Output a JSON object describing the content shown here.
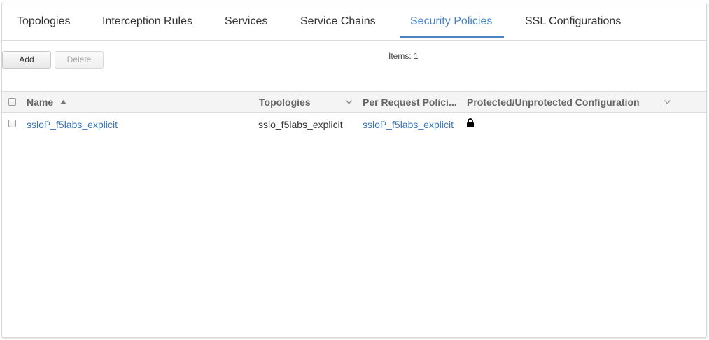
{
  "tabs": [
    {
      "label": "Topologies"
    },
    {
      "label": "Interception Rules"
    },
    {
      "label": "Services"
    },
    {
      "label": "Service Chains"
    },
    {
      "label": "Security Policies",
      "active": true
    },
    {
      "label": "SSL Configurations"
    }
  ],
  "toolbar": {
    "add_label": "Add",
    "delete_label": "Delete",
    "items_count": "Items: 1"
  },
  "table": {
    "columns": [
      {
        "label": "Name",
        "sort": "ascending"
      },
      {
        "label": "Topologies"
      },
      {
        "label": "Per Request Polici..."
      },
      {
        "label": "Protected/Unprotected Configuration"
      }
    ],
    "rows": [
      {
        "name": "ssloP_f5labs_explicit",
        "topologies": "sslo_f5labs_explicit",
        "per_request_policy": "ssloP_f5labs_explicit",
        "protected_icon": "lock-icon"
      }
    ]
  },
  "colors": {
    "accent": "#4a86c5",
    "link": "#3a77b7",
    "header_bg": "#f4f4f4"
  }
}
